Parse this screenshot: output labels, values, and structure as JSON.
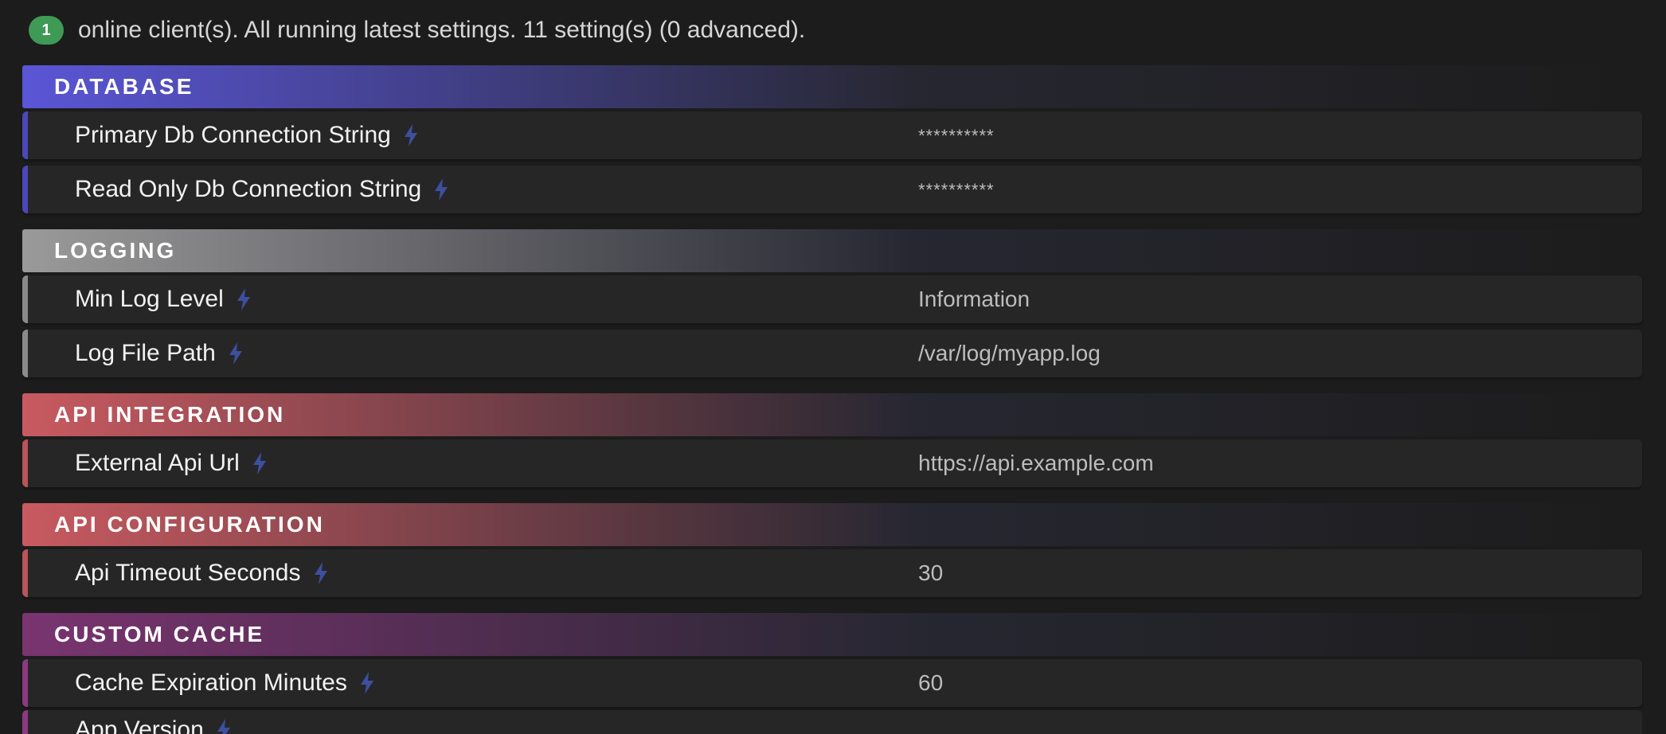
{
  "status": {
    "online_count": "1",
    "text": "online client(s). All running latest settings. 11 setting(s) (0 advanced)."
  },
  "sections": [
    {
      "title": "DATABASE",
      "gradient_start": "#5a56d6",
      "accent": "#4b48b8",
      "settings": [
        {
          "name": "Primary Db Connection String",
          "value": "**********",
          "masked": true
        },
        {
          "name": "Read Only Db Connection String",
          "value": "**********",
          "masked": true
        }
      ]
    },
    {
      "title": "LOGGING",
      "gradient_start": "#9a9a9a",
      "accent": "#8a8a8a",
      "settings": [
        {
          "name": "Min Log Level",
          "value": "Information",
          "masked": false
        },
        {
          "name": "Log File Path",
          "value": "/var/log/myapp.log",
          "masked": false
        }
      ]
    },
    {
      "title": "API INTEGRATION",
      "gradient_start": "#c85a60",
      "accent": "#b8545a",
      "settings": [
        {
          "name": "External Api Url",
          "value": "https://api.example.com",
          "masked": false
        }
      ]
    },
    {
      "title": "API CONFIGURATION",
      "gradient_start": "#c85a60",
      "accent": "#b8545a",
      "settings": [
        {
          "name": "Api Timeout Seconds",
          "value": "30",
          "masked": false
        }
      ]
    },
    {
      "title": "CUSTOM CACHE",
      "gradient_start": "#7a3470",
      "accent": "#8a3a80",
      "settings": [
        {
          "name": "Cache Expiration Minutes",
          "value": "60",
          "masked": false
        }
      ]
    }
  ],
  "partial_setting": {
    "name": "App Version"
  },
  "icons": {
    "setting_icon": "lightning-bolt-icon",
    "bolt_color": "#3d4f9e"
  }
}
